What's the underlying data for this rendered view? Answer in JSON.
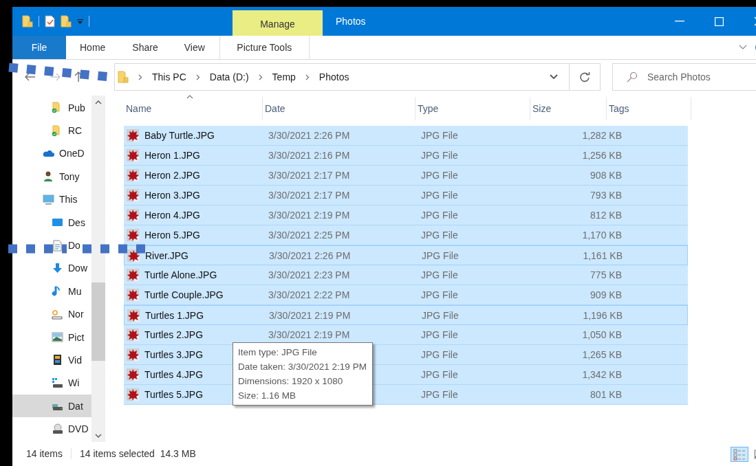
{
  "window": {
    "title": "Photos",
    "context_tab": "Manage"
  },
  "ribbon": {
    "tabs": [
      {
        "label": "File",
        "kind": "file",
        "selected": false
      },
      {
        "label": "Home",
        "kind": "tab",
        "selected": false
      },
      {
        "label": "Share",
        "kind": "tab",
        "selected": false
      },
      {
        "label": "View",
        "kind": "tab",
        "selected": false
      },
      {
        "label": "Picture Tools",
        "kind": "context",
        "selected": false
      }
    ]
  },
  "address": {
    "crumbs": [
      "This PC",
      "Data (D:)",
      "Temp",
      "Photos"
    ]
  },
  "search": {
    "placeholder": "Search Photos"
  },
  "sidebar": {
    "items": [
      {
        "label": "Pub",
        "kind": "synced-folder",
        "selected": false
      },
      {
        "label": "RC",
        "kind": "synced-folder",
        "selected": false
      },
      {
        "label": "OneD",
        "kind": "cloud",
        "selected": false
      },
      {
        "label": "Tony",
        "kind": "user",
        "selected": false
      },
      {
        "label": "This",
        "kind": "pc",
        "selected": false
      },
      {
        "label": "Des",
        "kind": "desktop",
        "selected": false
      },
      {
        "label": "Do",
        "kind": "documents",
        "selected": false
      },
      {
        "label": "Dow",
        "kind": "downloads",
        "selected": false
      },
      {
        "label": "Mu",
        "kind": "music",
        "selected": false
      },
      {
        "label": "Nor",
        "kind": "network",
        "selected": false
      },
      {
        "label": "Pict",
        "kind": "pictures",
        "selected": false
      },
      {
        "label": "Vid",
        "kind": "videos",
        "selected": false
      },
      {
        "label": "Wi",
        "kind": "windrive",
        "selected": false
      },
      {
        "label": "Dat",
        "kind": "drive",
        "selected": true
      },
      {
        "label": "DVD",
        "kind": "dvd",
        "selected": false
      }
    ]
  },
  "table": {
    "columns": [
      "Name",
      "Date",
      "Type",
      "Size",
      "Tags"
    ],
    "rows": [
      {
        "name": "Baby Turtle.JPG",
        "date": "3/30/2021 2:26 PM",
        "type": "JPG File",
        "size": "1,282 KB",
        "selected": true,
        "focused": false
      },
      {
        "name": "Heron 1.JPG",
        "date": "3/30/2021 2:16 PM",
        "type": "JPG File",
        "size": "1,256 KB",
        "selected": true,
        "focused": false
      },
      {
        "name": "Heron 2.JPG",
        "date": "3/30/2021 2:17 PM",
        "type": "JPG File",
        "size": "908 KB",
        "selected": true,
        "focused": false
      },
      {
        "name": "Heron 3.JPG",
        "date": "3/30/2021 2:17 PM",
        "type": "JPG File",
        "size": "793 KB",
        "selected": true,
        "focused": false
      },
      {
        "name": "Heron 4.JPG",
        "date": "3/30/2021 2:19 PM",
        "type": "JPG File",
        "size": "812 KB",
        "selected": true,
        "focused": false
      },
      {
        "name": "Heron 5.JPG",
        "date": "3/30/2021 2:25 PM",
        "type": "JPG File",
        "size": "1,170 KB",
        "selected": true,
        "focused": false
      },
      {
        "name": "River.JPG",
        "date": "3/30/2021 2:26 PM",
        "type": "JPG File",
        "size": "1,161 KB",
        "selected": true,
        "focused": true
      },
      {
        "name": "Turtle Alone.JPG",
        "date": "3/30/2021 2:23 PM",
        "type": "JPG File",
        "size": "775 KB",
        "selected": true,
        "focused": false
      },
      {
        "name": "Turtle Couple.JPG",
        "date": "3/30/2021 2:22 PM",
        "type": "JPG File",
        "size": "909 KB",
        "selected": true,
        "focused": false
      },
      {
        "name": "Turtles 1.JPG",
        "date": "3/30/2021 2:19 PM",
        "type": "JPG File",
        "size": "1,196 KB",
        "selected": true,
        "focused": true
      },
      {
        "name": "Turtles 2.JPG",
        "date": "3/30/2021 2:19 PM",
        "type": "JPG File",
        "size": "1,050 KB",
        "selected": true,
        "focused": false
      },
      {
        "name": "Turtles 3.JPG",
        "type": "JPG File",
        "size": "1,265 KB",
        "selected": true,
        "focused": false
      },
      {
        "name": "Turtles 4.JPG",
        "type": "JPG File",
        "size": "1,342 KB",
        "selected": true,
        "focused": false
      },
      {
        "name": "Turtles 5.JPG",
        "type": "JPG File",
        "size": "801 KB",
        "selected": true,
        "focused": false
      }
    ]
  },
  "tooltip": {
    "lines": [
      "Item type: JPG File",
      "Date taken: 3/30/2021 2:19 PM",
      "Dimensions: 1920 x 1080",
      "Size: 1.16 MB"
    ]
  },
  "status_bar": {
    "count": "14 items",
    "selection": "14 items selected  14.3 MB"
  },
  "views": [
    {
      "kind": "details",
      "selected": true
    },
    {
      "kind": "large-icons",
      "selected": false
    }
  ]
}
